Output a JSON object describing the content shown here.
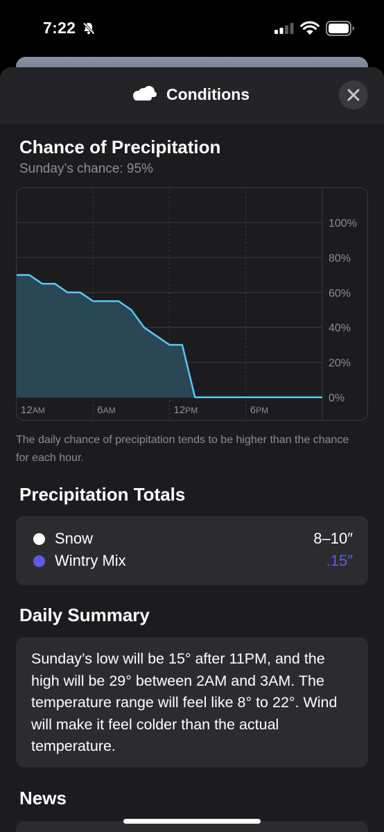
{
  "status_bar": {
    "time": "7:22",
    "icons": [
      "bell-slash-icon",
      "signal-icon",
      "wifi-icon",
      "battery-icon"
    ]
  },
  "sheet": {
    "title": "Conditions",
    "title_icon": "cloud-icon",
    "close_icon": "close-icon"
  },
  "precipitation_chance": {
    "title": "Chance of Precipitation",
    "subtitle": "Sunday’s chance: 95%",
    "note": "The daily chance of precipitation tends to be higher than the chance for each hour."
  },
  "chart_data": {
    "type": "area",
    "title": "Chance of Precipitation",
    "x_tick_labels": [
      "12AM",
      "6AM",
      "12PM",
      "6PM"
    ],
    "y_tick_labels": [
      "100%",
      "80%",
      "60%",
      "40%",
      "20%",
      "0%"
    ],
    "ylim": [
      0,
      100
    ],
    "xlim": [
      0,
      24
    ],
    "grid": true,
    "x": [
      0,
      1,
      2,
      3,
      4,
      5,
      6,
      7,
      8,
      9,
      10,
      11,
      12,
      13,
      14,
      15,
      16,
      17,
      18,
      19,
      20,
      21,
      22,
      23,
      24
    ],
    "series": [
      {
        "values": [
          70,
          70,
          65,
          65,
          60,
          60,
          55,
          55,
          55,
          50,
          40,
          35,
          30,
          30,
          0,
          0,
          0,
          0,
          0,
          0,
          0,
          0,
          0,
          0,
          0
        ]
      }
    ],
    "colors": {
      "line": "#5ac8fa",
      "fill": "#2a4a57"
    }
  },
  "totals": {
    "title": "Precipitation Totals",
    "items": [
      {
        "label": "Snow",
        "value": "8–10″",
        "dot_color": "#ffffff",
        "value_color": "#ffffff"
      },
      {
        "label": "Wintry Mix",
        "value": ".15″",
        "dot_color": "#5e5ce6",
        "value_color": "#5e5ce6"
      }
    ]
  },
  "daily_summary": {
    "title": "Daily Summary",
    "text": "Sunday’s low will be 15° after 11PM, and the high will be 29° between 2AM and 3AM. The temperature range will feel like 8° to 22°. Wind will make it feel colder than the actual temperature."
  },
  "news": {
    "title": "News"
  }
}
